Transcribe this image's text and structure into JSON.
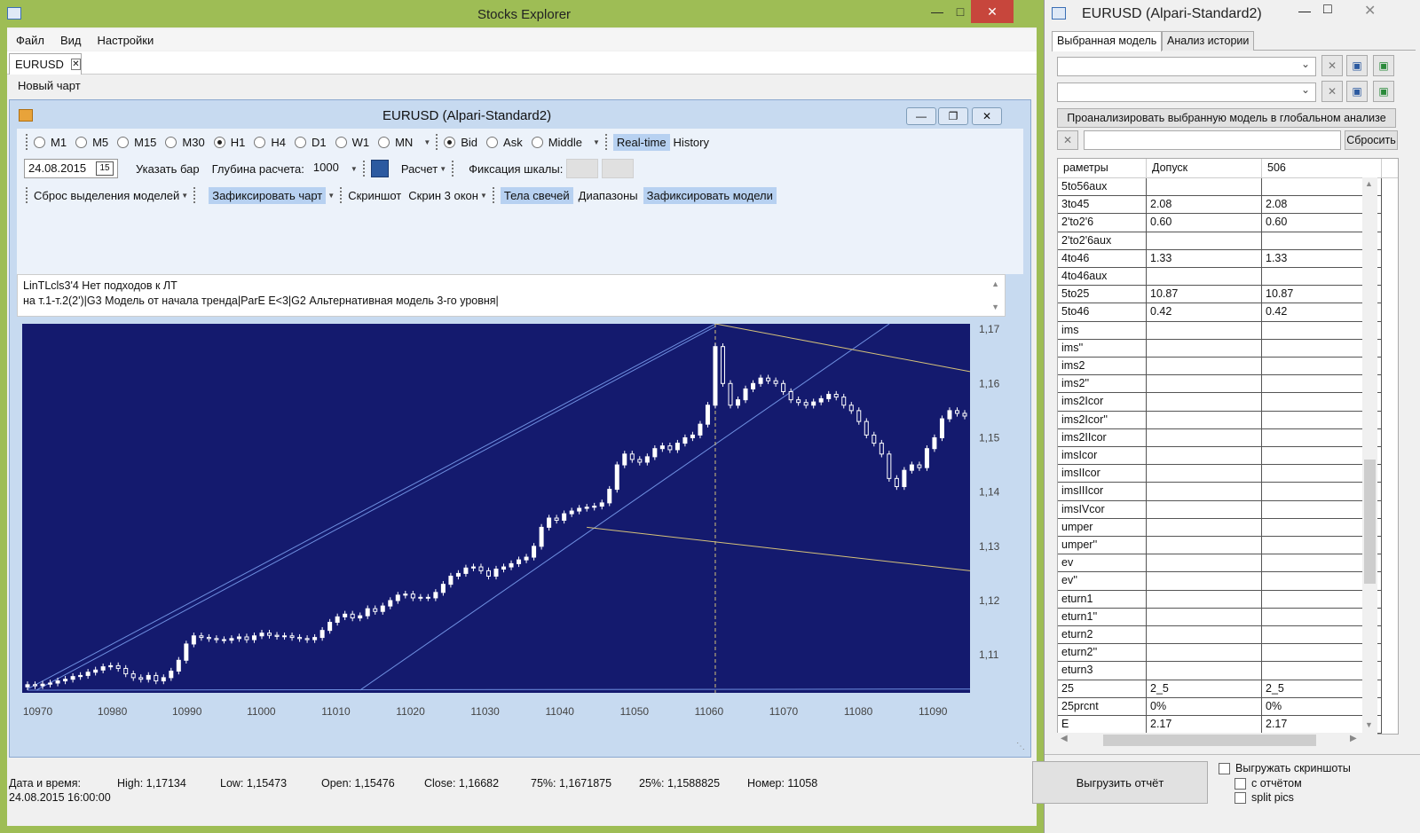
{
  "main_window": {
    "title": "Stocks Explorer",
    "menu": [
      "Файл",
      "Вид",
      "Настройки"
    ],
    "doc_tab": "EURUSD",
    "new_chart": "Новый чарт"
  },
  "chart_window": {
    "title": "EURUSD (Alpari-Standard2)",
    "timeframes": [
      {
        "label": "M1",
        "selected": false
      },
      {
        "label": "M5",
        "selected": false
      },
      {
        "label": "M15",
        "selected": false
      },
      {
        "label": "M30",
        "selected": false
      },
      {
        "label": "H1",
        "selected": true
      },
      {
        "label": "H4",
        "selected": false
      },
      {
        "label": "D1",
        "selected": false
      },
      {
        "label": "W1",
        "selected": false
      },
      {
        "label": "MN",
        "selected": false
      }
    ],
    "price_types": [
      {
        "label": "Bid",
        "selected": true
      },
      {
        "label": "Ask",
        "selected": false
      },
      {
        "label": "Middle",
        "selected": false
      }
    ],
    "realtime": "Real-time",
    "history": "History",
    "date_value": "24.08.2015",
    "calendar_day": "15",
    "specify_bar": "Указать бар",
    "depth_label": "Глубина расчета:",
    "depth_value": "1000",
    "calc": "Расчет",
    "scale_fix": "Фиксация шкалы:",
    "reset_selection": "Сброс выделения моделей",
    "fix_chart": "Зафиксировать чарт",
    "screenshot": "Скриншот",
    "screen3": "Скрин 3 окон",
    "candle_bodies": "Тела свечей",
    "ranges": "Диапазоны",
    "fix_models": "Зафиксировать модели",
    "info_line1": "LinTLcls3'4 Нет подходов к ЛТ",
    "info_line2": "на т.1-т.2(2')|G3 Модель от начала тренда|ParE E<3|G2 Альтернативная модель 3-го уровня|"
  },
  "chart_data": {
    "type": "candlestick",
    "instrument": "EURUSD",
    "timeframe": "H1",
    "xlim": [
      10968,
      10095
    ],
    "ylim": [
      1.103,
      1.171
    ],
    "x_ticks": [
      10970,
      10980,
      10990,
      11000,
      11010,
      11020,
      11030,
      11040,
      11050,
      11060,
      11070,
      11080,
      11090
    ],
    "y_ticks": [
      "1,17",
      "1,16",
      "1,15",
      "1,14",
      "1,13",
      "1,12",
      "1,11"
    ],
    "background": "#141a6e",
    "candle_color": "#ffffff",
    "trend_line_color": "#6f8fe0",
    "level_line_color": "#d6c27a",
    "closes": [
      1.1045,
      1.1043,
      1.1046,
      1.1048,
      1.1052,
      1.1055,
      1.106,
      1.1062,
      1.1068,
      1.1072,
      1.1078,
      1.108,
      1.1075,
      1.1065,
      1.1058,
      1.1055,
      1.1062,
      1.1052,
      1.1058,
      1.107,
      1.109,
      1.112,
      1.1135,
      1.1132,
      1.113,
      1.1128,
      1.1127,
      1.113,
      1.1133,
      1.1128,
      1.1135,
      1.114,
      1.1136,
      1.1134,
      1.1135,
      1.1132,
      1.113,
      1.1128,
      1.1132,
      1.1145,
      1.116,
      1.117,
      1.1175,
      1.1168,
      1.1172,
      1.1185,
      1.118,
      1.119,
      1.12,
      1.121,
      1.1212,
      1.1205,
      1.1206,
      1.1205,
      1.1215,
      1.123,
      1.1245,
      1.125,
      1.126,
      1.1262,
      1.1255,
      1.1245,
      1.1258,
      1.1262,
      1.1268,
      1.1275,
      1.128,
      1.13,
      1.1335,
      1.1352,
      1.1348,
      1.136,
      1.1365,
      1.137,
      1.1372,
      1.1374,
      1.138,
      1.1405,
      1.145,
      1.147,
      1.146,
      1.1455,
      1.1465,
      1.148,
      1.1485,
      1.1478,
      1.149,
      1.15,
      1.1505,
      1.1525,
      1.156,
      1.1668,
      1.16,
      1.156,
      1.157,
      1.159,
      1.16,
      1.161,
      1.1605,
      1.16,
      1.1585,
      1.157,
      1.1565,
      1.156,
      1.1566,
      1.1572,
      1.158,
      1.1575,
      1.156,
      1.155,
      1.153,
      1.1505,
      1.149,
      1.147,
      1.1425,
      1.141,
      1.144,
      1.145,
      1.1445,
      1.148,
      1.15,
      1.1535,
      1.155,
      1.1545,
      1.154
    ]
  },
  "status": {
    "datetime_label": "Дата и время:",
    "datetime": "24.08.2015 16:00:00",
    "high": "High: 1,17134",
    "low": "Low: 1,15473",
    "open": "Open: 1,15476",
    "close": "Close: 1,16682",
    "p75": "75%: 1,1671875",
    "p25": "25%: 1,1588825",
    "number": "Номер: 11058"
  },
  "right_panel": {
    "title": "EURUSD (Alpari-Standard2)",
    "tabs": [
      "Выбранная модель",
      "Анализ истории"
    ],
    "analyze_button": "Проанализировать выбранную модель в глобальном анализе",
    "reset_button": "Сбросить",
    "columns": [
      "раметры",
      "Допуск",
      "506"
    ],
    "rows": [
      [
        "5to56aux",
        "",
        ""
      ],
      [
        "3to45",
        "2.08",
        "2.08"
      ],
      [
        "2'to2'6",
        "0.60",
        "0.60"
      ],
      [
        "2'to2'6aux",
        "",
        ""
      ],
      [
        "4to46",
        "1.33",
        "1.33"
      ],
      [
        "4to46aux",
        "",
        ""
      ],
      [
        "5to25",
        "10.87",
        "10.87"
      ],
      [
        "5to46",
        "0.42",
        "0.42"
      ],
      [
        "ims",
        "",
        ""
      ],
      [
        "ims''",
        "",
        ""
      ],
      [
        "ims2",
        "",
        ""
      ],
      [
        "ims2''",
        "",
        ""
      ],
      [
        "ims2Icor",
        "",
        ""
      ],
      [
        "ims2Icor''",
        "",
        ""
      ],
      [
        "ims2IIcor",
        "",
        ""
      ],
      [
        "imsIcor",
        "",
        ""
      ],
      [
        "imsIIcor",
        "",
        ""
      ],
      [
        "imsIIIcor",
        "",
        ""
      ],
      [
        "imsIVcor",
        "",
        ""
      ],
      [
        "umper",
        "",
        ""
      ],
      [
        "umper''",
        "",
        ""
      ],
      [
        "ev",
        "",
        ""
      ],
      [
        "ev''",
        "",
        ""
      ],
      [
        "eturn1",
        "",
        ""
      ],
      [
        "eturn1''",
        "",
        ""
      ],
      [
        "eturn2",
        "",
        ""
      ],
      [
        "eturn2''",
        "",
        ""
      ],
      [
        "eturn3",
        "",
        ""
      ],
      [
        "25",
        "2_5",
        "2_5"
      ],
      [
        "25prcnt",
        "0%",
        "0%"
      ],
      [
        "E",
        "2.17",
        "2.17"
      ]
    ],
    "export_button": "Выгрузить отчёт",
    "check_screens": "Выгружать скриншоты",
    "check_with_report": "с отчётом",
    "check_split": "split pics"
  }
}
